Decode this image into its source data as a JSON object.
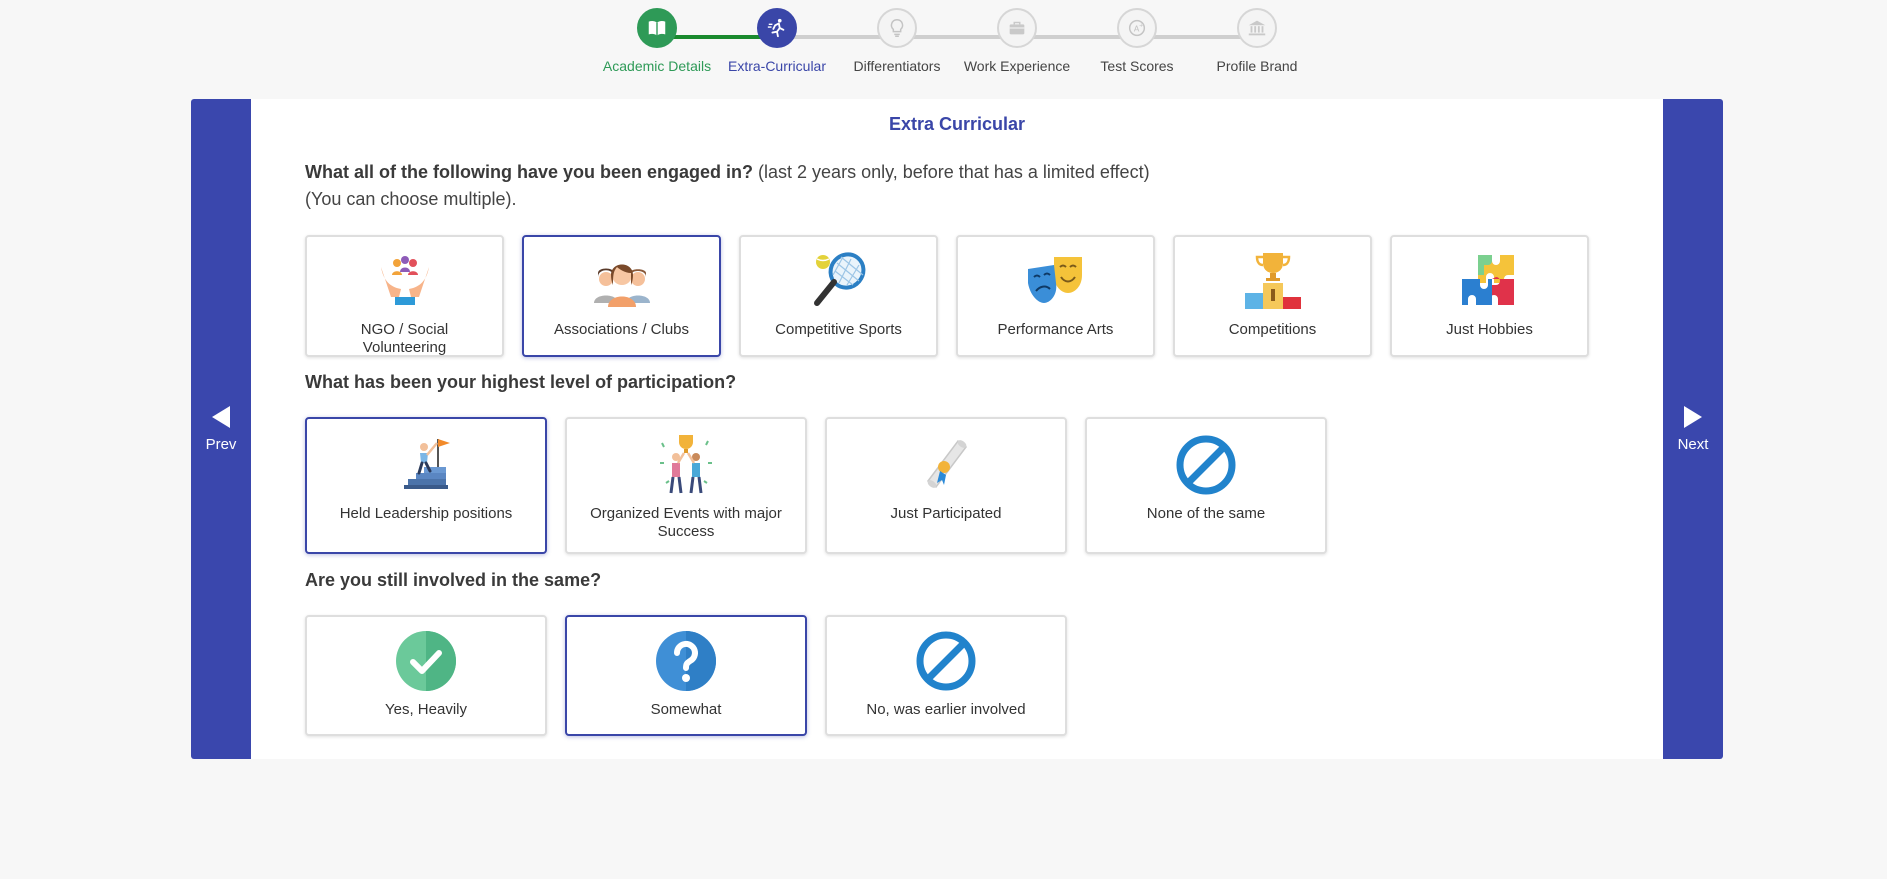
{
  "stepper": {
    "steps": [
      {
        "label": "Academic Details",
        "state": "complete",
        "icon": "book-icon"
      },
      {
        "label": "Extra-Curricular",
        "state": "active",
        "icon": "runner-icon"
      },
      {
        "label": "Differentiators",
        "state": "pending",
        "icon": "lightbulb-icon"
      },
      {
        "label": "Work Experience",
        "state": "pending",
        "icon": "briefcase-icon"
      },
      {
        "label": "Test Scores",
        "state": "pending",
        "icon": "grade-icon"
      },
      {
        "label": "Profile Brand",
        "state": "pending",
        "icon": "institution-icon"
      }
    ]
  },
  "nav": {
    "prev_label": "Prev",
    "next_label": "Next"
  },
  "page": {
    "section_title": "Extra Curricular"
  },
  "q1": {
    "question_bold": "What all of the following have you been engaged in?",
    "question_rest": " (last 2 years only, before that has a limited effect)",
    "question_line2": "(You can choose multiple).",
    "options": [
      {
        "label": "NGO / Social Volunteering",
        "icon": "volunteer-hands-icon",
        "selected": false
      },
      {
        "label": "Associations / Clubs",
        "icon": "group-people-icon",
        "selected": true
      },
      {
        "label": "Competitive Sports",
        "icon": "tennis-racket-icon",
        "selected": false
      },
      {
        "label": "Performance Arts",
        "icon": "theatre-masks-icon",
        "selected": false
      },
      {
        "label": "Competitions",
        "icon": "trophy-podium-icon",
        "selected": false
      },
      {
        "label": "Just Hobbies",
        "icon": "puzzle-icon",
        "selected": false
      }
    ]
  },
  "q2": {
    "question": "What has been your highest level of participation?",
    "options": [
      {
        "label": "Held Leadership positions",
        "icon": "leader-flag-icon",
        "selected": true
      },
      {
        "label": "Organized Events with major Success",
        "icon": "team-trophy-icon",
        "selected": false
      },
      {
        "label": "Just Participated",
        "icon": "certificate-icon",
        "selected": false
      },
      {
        "label": "None of the same",
        "icon": "prohibited-icon",
        "selected": false
      }
    ]
  },
  "q3": {
    "question": "Are you still involved in the same?",
    "options": [
      {
        "label": "Yes, Heavily",
        "icon": "check-circle-icon",
        "selected": false
      },
      {
        "label": "Somewhat",
        "icon": "question-circle-icon",
        "selected": true
      },
      {
        "label": "No, was earlier involved",
        "icon": "prohibited-icon",
        "selected": false
      }
    ]
  },
  "colors": {
    "primary": "#3a46a8",
    "complete": "#2e9a57",
    "progress_line": "#1a8a2e"
  }
}
